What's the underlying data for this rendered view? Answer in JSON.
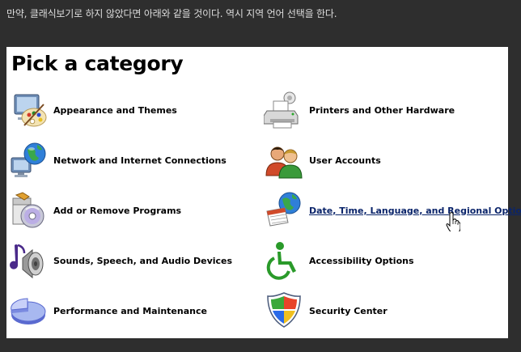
{
  "caption": "만약, 클래식보기로 하지 않았다면 아래와 같을 것이다. 역시  지역 언어 선택을 한다.",
  "panel": {
    "title": "Pick a category",
    "categories_left": [
      {
        "label": "Appearance and Themes",
        "icon": "appearance-themes-icon"
      },
      {
        "label": "Network and Internet Connections",
        "icon": "network-globe-icon"
      },
      {
        "label": "Add or Remove Programs",
        "icon": "add-remove-programs-icon"
      },
      {
        "label": "Sounds, Speech, and Audio Devices",
        "icon": "speaker-icon"
      },
      {
        "label": "Performance and Maintenance",
        "icon": "pie-chart-icon"
      }
    ],
    "categories_right": [
      {
        "label": "Printers and Other Hardware",
        "icon": "printer-icon"
      },
      {
        "label": "User Accounts",
        "icon": "users-icon"
      },
      {
        "label": "Date, Time, Language, and Regional Options",
        "icon": "globe-calendar-icon"
      },
      {
        "label": "Accessibility Options",
        "icon": "wheelchair-icon"
      },
      {
        "label": "Security Center",
        "icon": "shield-icon"
      }
    ]
  },
  "colors": {
    "background": "#2e2e2e",
    "panel": "#ffffff",
    "hover_link": "#0a246a"
  }
}
